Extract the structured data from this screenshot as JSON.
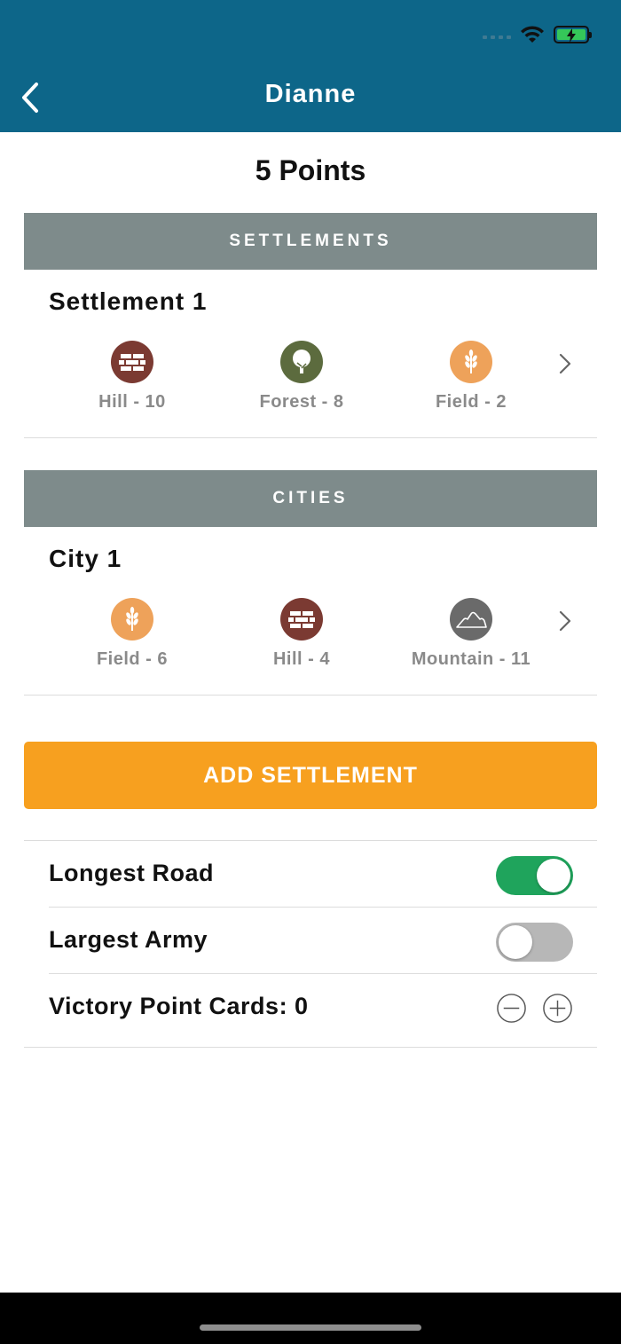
{
  "nav": {
    "title": "Dianne"
  },
  "score": {
    "points_label": "5 Points"
  },
  "settlements": {
    "header": "SETTLEMENTS",
    "items": [
      {
        "name": "Settlement 1",
        "resources": [
          {
            "label": "Hill - 10",
            "icon": "brick-icon",
            "color": "#7b3a32"
          },
          {
            "label": "Forest - 8",
            "icon": "tree-icon",
            "color": "#5c6b3e"
          },
          {
            "label": "Field - 2",
            "icon": "wheat-icon",
            "color": "#eea25a"
          }
        ]
      }
    ]
  },
  "cities": {
    "header": "CITIES",
    "items": [
      {
        "name": "City 1",
        "resources": [
          {
            "label": "Field - 6",
            "icon": "wheat-icon",
            "color": "#eea25a"
          },
          {
            "label": "Hill - 4",
            "icon": "brick-icon",
            "color": "#7b3a32"
          },
          {
            "label": "Mountain - 11",
            "icon": "mountain-icon",
            "color": "#6a6a6a"
          }
        ]
      }
    ]
  },
  "actions": {
    "add_settlement": "ADD SETTLEMENT"
  },
  "settings": {
    "longest_road": {
      "label": "Longest Road",
      "on": true
    },
    "largest_army": {
      "label": "Largest Army",
      "on": false
    },
    "victory_points": {
      "label": "Victory Point Cards: 0"
    }
  },
  "colors": {
    "header_bg": "#0d6689",
    "section_bg": "#7e8b8b",
    "accent": "#f7a01f",
    "toggle_on": "#1fa45c",
    "battery": "#35c759"
  }
}
